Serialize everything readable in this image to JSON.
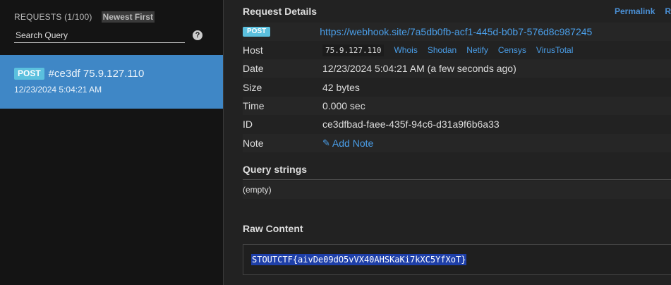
{
  "sidebar": {
    "requests_label": "REQUESTS (1/100)",
    "sort_label": "Newest First",
    "search_placeholder": "Search Query",
    "help_label": "?",
    "selected_request": {
      "method": "POST",
      "id_and_ip": "#ce3df 75.9.127.110",
      "date": "12/23/2024 5:04:21 AM"
    }
  },
  "main": {
    "details_title": "Request Details",
    "top_links": [
      "Permalink",
      "R"
    ],
    "method": "POST",
    "url": "https://webhook.site/7a5db0fb-acf1-445d-b0b7-576d8c987245",
    "host": {
      "label": "Host",
      "ip": "75.9.127.110",
      "links": [
        "Whois",
        "Shodan",
        "Netify",
        "Censys",
        "VirusTotal"
      ]
    },
    "date": {
      "label": "Date",
      "value": "12/23/2024 5:04:21 AM (a few seconds ago)"
    },
    "size": {
      "label": "Size",
      "value": "42 bytes"
    },
    "time": {
      "label": "Time",
      "value": "0.000 sec"
    },
    "id": {
      "label": "ID",
      "value": "ce3dfbad-faee-435f-94c6-d31a9f6b6a33"
    },
    "note": {
      "label": "Note",
      "add_label": "Add Note"
    },
    "query_title": "Query strings",
    "query_empty": "(empty)",
    "raw_title": "Raw Content",
    "raw_content": "STOUTCTF{aivDe09dO5vVX40AHSKaKi7kXC5YfXoT}"
  },
  "colors": {
    "accent": "#3f87c6",
    "badge": "#5bc0de",
    "link": "#4a9ee8",
    "selection": "#1e3fa8"
  },
  "icons": {
    "help": "question-circle-icon",
    "note": "pencil-icon"
  }
}
